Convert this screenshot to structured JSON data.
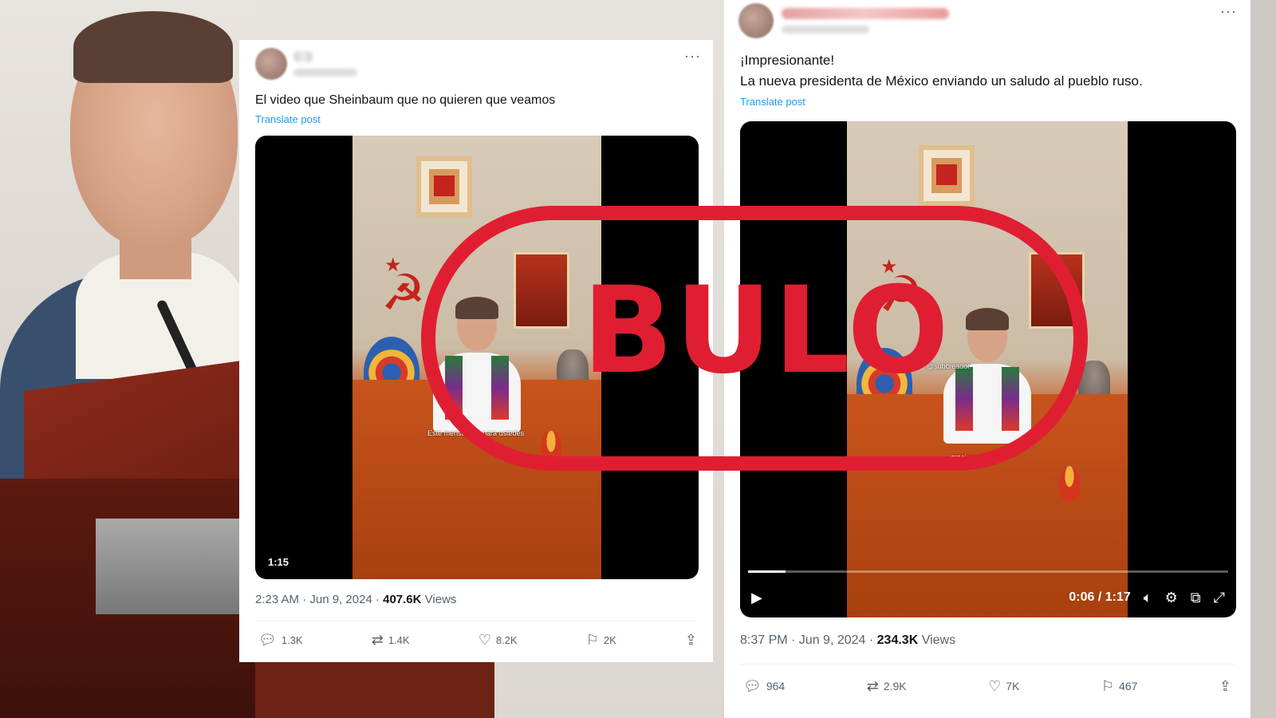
{
  "stamp": {
    "text": "BULO",
    "color": "#e01e32"
  },
  "tweet_left": {
    "text": "El video que Sheinbaum que no quieren que veamos",
    "translate_label": "Translate post",
    "video_duration": "1:15",
    "video_subtitle": "Este mensaje es para ustedes",
    "timestamp": "2:23 AM · Jun 9, 2024 ·",
    "views_count": "407.6K",
    "views_label": "Views",
    "replies": "1.3K",
    "reposts": "1.4K",
    "likes": "8.2K",
    "bookmarks": "2K"
  },
  "tweet_right": {
    "text_line1": "¡Impresionante!",
    "text_line2": "La nueva presidenta de México enviando un saludo al pueblo ruso.",
    "translate_label": "Translate post",
    "video_time": "0:06 / 1:17",
    "video_progress": 0.078,
    "video_subtitle": "gracias, gracias",
    "video_tag": "@subcreador",
    "timestamp": "8:37 PM · Jun 9, 2024 ·",
    "views_count": "234.3K",
    "views_label": "Views",
    "replies": "964",
    "reposts": "2.9K",
    "likes": "7K",
    "bookmarks": "467"
  },
  "icons": {
    "more": "more-icon",
    "reply": "reply-icon",
    "repost": "repost-icon",
    "like": "heart-icon",
    "bookmark": "bookmark-icon",
    "share": "share-icon",
    "play": "play-icon",
    "volume": "volume-icon",
    "settings": "gear-icon",
    "pip": "pip-icon",
    "fullscreen": "fullscreen-icon"
  },
  "colors": {
    "link": "#1d9bf0",
    "text": "#0f1419",
    "muted": "#536471"
  }
}
